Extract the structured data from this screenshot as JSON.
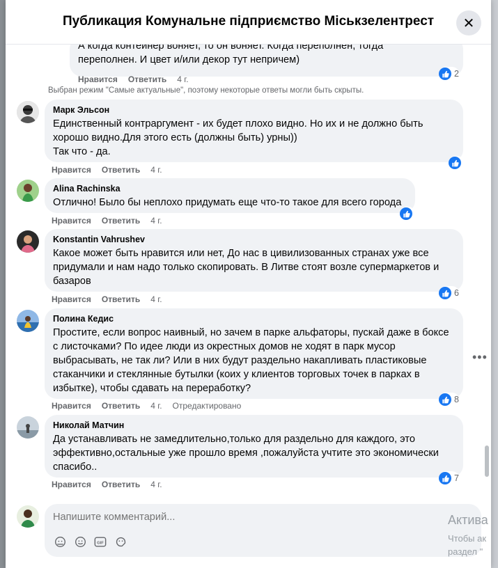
{
  "header": {
    "title": "Публикация Комунальне підприємство Міськзелентрест",
    "close_glyph": "✕"
  },
  "prev_comment": {
    "text_line1": "А когда контейнер воняет, то он воняет. Когда переполнен, тогда",
    "text_line2": "переполнен. И цвет и/или декор тут непричем)",
    "like": "Нравится",
    "reply": "Ответить",
    "time": "4 г.",
    "reactions": "2"
  },
  "notice": "Выбран режим \"Самые актуальные\", поэтому некоторые ответы могли быть скрыты.",
  "comments": [
    {
      "author": "Марк Эльсон",
      "lines": [
        "Единственный контраргумент - их будет плохо видно. Но их и не должно быть",
        "хорошо видно.Для этого есть (должны быть) урны))",
        "Так что - да."
      ],
      "like": "Нравится",
      "reply": "Ответить",
      "time": "4 г.",
      "reactions": ""
    },
    {
      "author": "Alina Rachinska",
      "lines": [
        "Отлично! Было бы неплохо придумать еще что-то такое для всего города"
      ],
      "like": "Нравится",
      "reply": "Ответить",
      "time": "4 г.",
      "reactions": ""
    },
    {
      "author": "Konstantin Vahrushev",
      "lines": [
        "Какое может быть нравится или нет, До нас в цивилизованных странах уже все",
        "придумали и нам надо только скопировать. В Литве стоят возле супермаркетов и",
        "базаров"
      ],
      "like": "Нравится",
      "reply": "Ответить",
      "time": "4 г.",
      "reactions": "6"
    },
    {
      "author": "Полина Кедис",
      "lines": [
        "Простите, если вопрос наивный, но зачем в парке альфаторы, пускай даже в боксе",
        "с листочками? По идее люди из окрестных домов не ходят в парк мусор",
        "выбрасывать, не так ли? Или в них будут раздельно накапливать пластиковые",
        "стаканчики и стеклянные бутылки (коих у клиентов торговых точек в парках в",
        "избытке), чтобы сдавать на переработку?"
      ],
      "like": "Нравится",
      "reply": "Ответить",
      "time": "4 г.",
      "edited": "Отредактировано",
      "reactions": "8"
    },
    {
      "author": "Николай Матчин",
      "lines": [
        "Да устанавливать не замедлительно,только для раздельно для каждого, это",
        "эффективно,остальные уже прошло время ,пожалуйста учтите это экономически",
        "спасибо.."
      ],
      "like": "Нравится",
      "reply": "Ответить",
      "time": "4 г.",
      "reactions": "7"
    }
  ],
  "composer": {
    "placeholder": "Напишите комментарий..."
  },
  "watermark": {
    "line1": "Актива",
    "line2": "Чтобы ак",
    "line3": "раздел \""
  },
  "icons": {
    "like": "like-thumb-icon",
    "more": "more-options-icon",
    "sticker": "sticker-icon",
    "emoji": "emoji-icon",
    "gif": "gif-icon",
    "avatar_sticker": "avatar-sticker-icon"
  },
  "colors": {
    "accent": "#1877f2",
    "bubble": "#f0f2f5",
    "muted": "#65676b"
  }
}
